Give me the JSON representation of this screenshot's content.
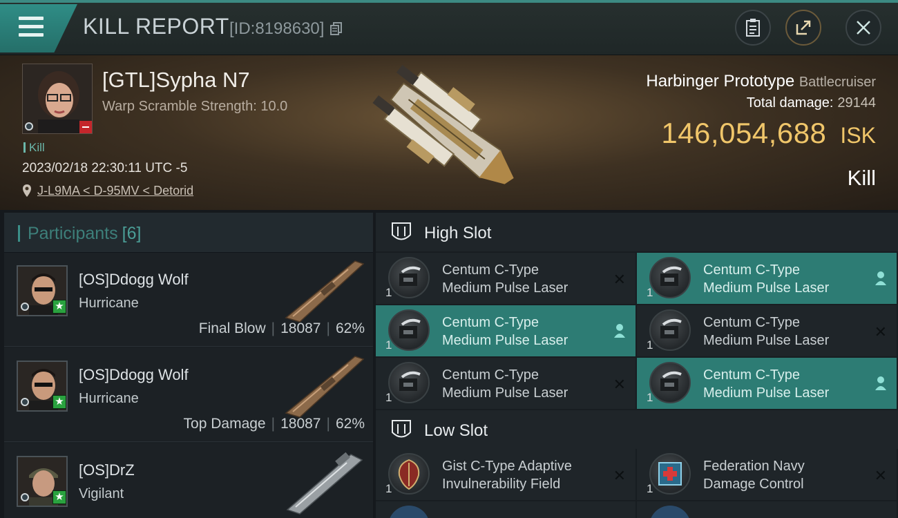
{
  "header": {
    "title": "KILL REPORT",
    "id_text": "[ID:8198630]"
  },
  "victim": {
    "name": "[GTL]Sypha N7",
    "warp_scramble": "Warp Scramble Strength: 10.0",
    "kill_tag": "Kill",
    "datetime": "2023/02/18 22:30:11 UTC -5",
    "location": "J-L9MA < D-95MV < Detorid",
    "ship": "Harbinger Prototype",
    "ship_class": "Battlecruiser",
    "total_damage_label": "Total damage:",
    "total_damage": "29144",
    "isk_value": "146,054,688",
    "isk_unit": "ISK",
    "result": "Kill"
  },
  "participants": {
    "title": "Participants",
    "count": "[6]",
    "rows": [
      {
        "name": "[OS]Ddogg Wolf",
        "ship": "Hurricane",
        "role": "Final Blow",
        "damage": "18087",
        "pct": "62%"
      },
      {
        "name": "[OS]Ddogg Wolf",
        "ship": "Hurricane",
        "role": "Top Damage",
        "damage": "18087",
        "pct": "62%"
      },
      {
        "name": "[OS]DrZ",
        "ship": "Vigilant",
        "role": "",
        "damage": "",
        "pct": ""
      }
    ]
  },
  "slots": {
    "high": {
      "label": "High Slot",
      "modules": [
        {
          "line1": "Centum C-Type",
          "line2": "Medium Pulse Laser",
          "qty": "1",
          "state": "destroyed"
        },
        {
          "line1": "Centum C-Type",
          "line2": "Medium Pulse Laser",
          "qty": "1",
          "state": "dropped"
        },
        {
          "line1": "Centum C-Type",
          "line2": "Medium Pulse Laser",
          "qty": "1",
          "state": "dropped"
        },
        {
          "line1": "Centum C-Type",
          "line2": "Medium Pulse Laser",
          "qty": "1",
          "state": "destroyed"
        },
        {
          "line1": "Centum C-Type",
          "line2": "Medium Pulse Laser",
          "qty": "1",
          "state": "destroyed"
        },
        {
          "line1": "Centum C-Type",
          "line2": "Medium Pulse Laser",
          "qty": "1",
          "state": "dropped"
        }
      ]
    },
    "low": {
      "label": "Low Slot",
      "modules": [
        {
          "line1": "Gist C-Type Adaptive",
          "line2": "Invulnerability Field",
          "qty": "1",
          "state": "destroyed"
        },
        {
          "line1": "Federation Navy",
          "line2": "Damage Control",
          "qty": "1",
          "state": "destroyed"
        }
      ]
    }
  },
  "colors": {
    "accent": "#2d7c74",
    "isk": "#f0c66a",
    "header_teal": "#2f8d86"
  },
  "icons": [
    "menu-icon",
    "copy-icon",
    "clipboard-icon",
    "share-icon",
    "close-icon",
    "location-pin-icon",
    "high-slot-icon",
    "low-slot-icon",
    "person-icon",
    "x-icon"
  ]
}
